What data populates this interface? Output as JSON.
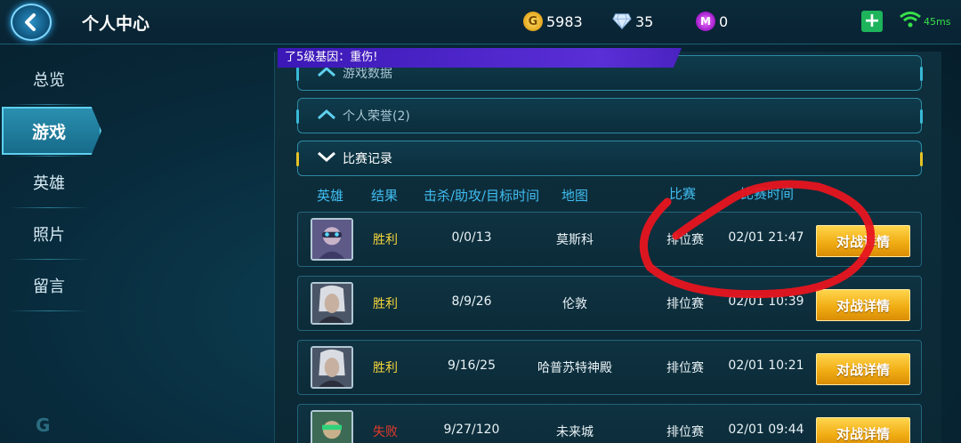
{
  "header": {
    "title": "个人中心",
    "gold": "5983",
    "diamonds": "35",
    "vouchers": "0",
    "ping": "45ms",
    "back_icon": "back-arrow-icon",
    "add_icon": "plus-icon",
    "signal_icon": "wifi-icon"
  },
  "sidebar": {
    "items": [
      {
        "label": "总览",
        "active": false
      },
      {
        "label": "游戏",
        "active": true
      },
      {
        "label": "英雄",
        "active": false
      },
      {
        "label": "照片",
        "active": false
      },
      {
        "label": "留言",
        "active": false
      }
    ],
    "logo": "G"
  },
  "banner": {
    "text": "了5级基因：重伤!"
  },
  "sections": {
    "game_data": "游戏数据",
    "honors": "个人荣誉(2)",
    "match_records": "比赛记录"
  },
  "table": {
    "headers": {
      "hero": "英雄",
      "result": "结果",
      "kda": "击杀/助攻/目标时间",
      "map": "地图",
      "mode": "比赛",
      "time": "比赛时间"
    },
    "rows": [
      {
        "result": "胜利",
        "kda": "0/0/13",
        "map": "莫斯科",
        "mode": "排位赛",
        "time": "02/01 21:47",
        "button": "对战详情",
        "outcome": "win"
      },
      {
        "result": "胜利",
        "kda": "8/9/26",
        "map": "伦敦",
        "mode": "排位赛",
        "time": "02/01 10:39",
        "button": "对战详情",
        "outcome": "win"
      },
      {
        "result": "胜利",
        "kda": "9/16/25",
        "map": "哈普苏特神殿",
        "mode": "排位赛",
        "time": "02/01 10:21",
        "button": "对战详情",
        "outcome": "win"
      },
      {
        "result": "失败",
        "kda": "9/27/120",
        "map": "未来城",
        "mode": "排位赛",
        "time": "02/01 09:44",
        "button": "对战详情",
        "outcome": "lose"
      }
    ]
  },
  "colors": {
    "win": "#f5d53a",
    "lose": "#e43a2b",
    "header_text": "#3fbdf0",
    "button": "#f1ad14",
    "banner": "#4a22c0",
    "annotation": "#e8151f"
  }
}
